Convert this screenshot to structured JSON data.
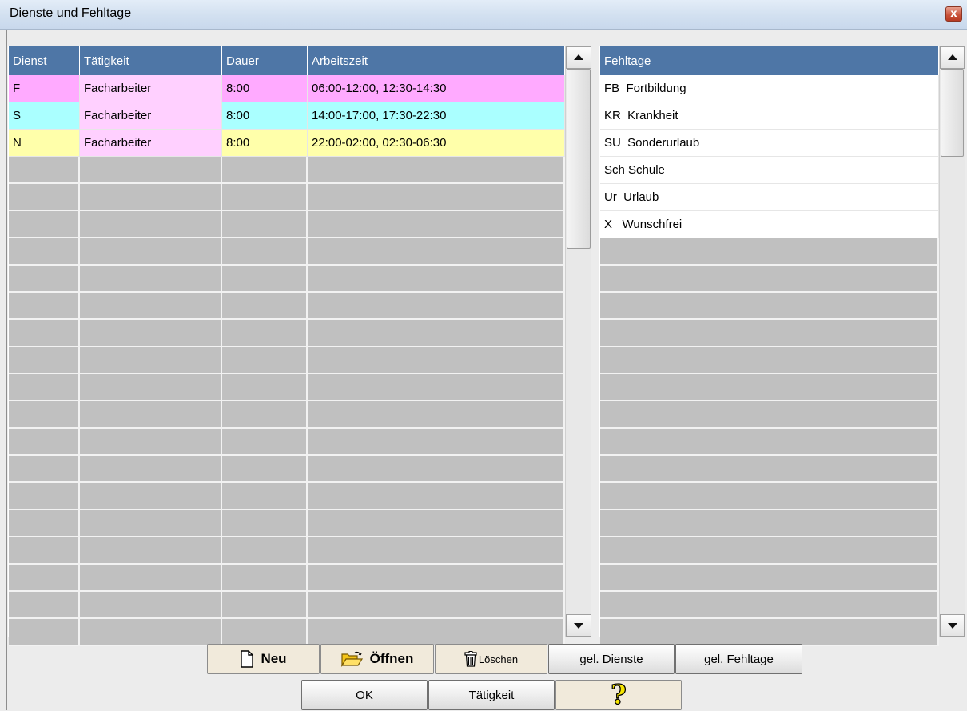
{
  "window": {
    "title": "Dienste und Fehltage",
    "close_glyph": "x"
  },
  "dienste": {
    "columns": [
      "Dienst",
      "Tätigkeit",
      "Dauer",
      "Arbeitszeit"
    ],
    "rows": [
      {
        "dienst": "F",
        "taetigkeit": "Facharbeiter",
        "dauer": "8:00",
        "arbeitszeit": "06:00-12:00, 12:30-14:30",
        "color": "#ffaaff"
      },
      {
        "dienst": "S",
        "taetigkeit": "Facharbeiter",
        "dauer": "8:00",
        "arbeitszeit": "14:00-17:00, 17:30-22:30",
        "color": "#aaffff"
      },
      {
        "dienst": "N",
        "taetigkeit": "Facharbeiter",
        "dauer": "8:00",
        "arbeitszeit": "22:00-02:00, 02:30-06:30",
        "color": "#ffffaa"
      }
    ],
    "taetigkeit_color": "#ffd0ff"
  },
  "fehltage": {
    "header": "Fehltage",
    "items": [
      "FB  Fortbildung",
      "KR  Krankheit",
      "SU  Sonderurlaub",
      "Sch Schule",
      "Ur  Urlaub",
      "X   Wunschfrei"
    ]
  },
  "buttons": {
    "neu": "Neu",
    "oeffnen": "Öffnen",
    "loeschen": "Löschen",
    "gel_dienste": "gel. Dienste",
    "gel_fehltage": "gel. Fehltage",
    "ok": "OK",
    "taetigkeit": "Tätigkeit",
    "help_glyph": "?"
  },
  "icons": {
    "neu": "new-document-icon",
    "oeffnen": "open-folder-icon",
    "loeschen": "trash-can-icon",
    "help": "question-mark-icon"
  }
}
